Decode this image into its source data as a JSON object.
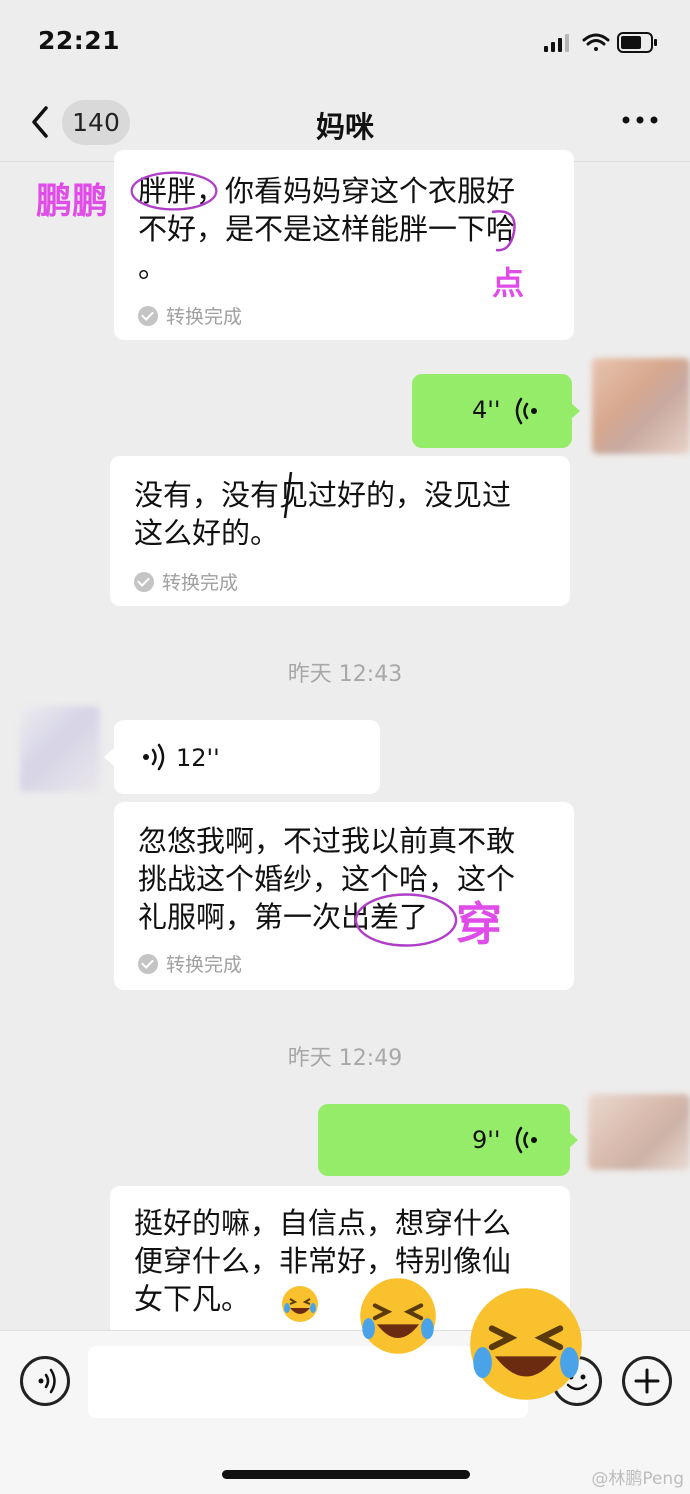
{
  "status_bar": {
    "time": "22:21"
  },
  "nav": {
    "badge": "140",
    "title": "妈咪"
  },
  "messages": {
    "m1_text": "胖胖，你看妈妈穿这个衣服好不好，是不是这样能胖一下哈。",
    "m1_l1": "胖胖，你看妈妈穿这个衣服好",
    "m1_l2": "不好，是不是这样能胖一下哈",
    "m1_l3": "。",
    "m1_status": "转换完成",
    "m2_duration": "4''",
    "m3_l1": "没有，没有见过好的，没见过",
    "m3_l2": "这么好的。",
    "m3_status": "转换完成",
    "ts1": "昨天 12:43",
    "m4_duration": "12''",
    "m5_l1": "忽悠我啊，不过我以前真不敢",
    "m5_l2": "挑战这个婚纱，这个哈，这个",
    "m5_l3": "礼服啊，第一次出差了",
    "m5_status": "转换完成",
    "ts2": "昨天 12:49",
    "m6_duration": "9''",
    "m7_l1": "挺好的嘛，自信点，想穿什么",
    "m7_l2": "便穿什么，非常好，特别像仙",
    "m7_l3": "女下凡。"
  },
  "annotations": {
    "name": "鹏鹏",
    "correction1": "点",
    "correction2": "穿"
  },
  "watermark": "@林鹏Peng",
  "icons": [
    "signal-icon",
    "wifi-icon",
    "battery-icon",
    "back-chevron-icon",
    "more-icon",
    "voice-wave-icon",
    "voice-input-icon",
    "emoji-icon",
    "plus-icon",
    "laughing-emoji"
  ],
  "colors": {
    "background": "#ededed",
    "sent_bubble": "#95ec69",
    "received_bubble": "#ffffff",
    "annotation": "#e04ce8"
  }
}
